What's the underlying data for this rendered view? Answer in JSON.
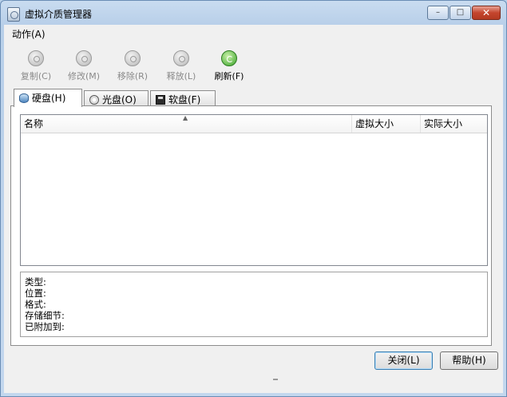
{
  "window": {
    "title": "虚拟介质管理器",
    "minimize_glyph": "–",
    "maximize_glyph": "□",
    "close_glyph": "✕"
  },
  "menubar": {
    "items": [
      {
        "label": "动作(A)"
      }
    ]
  },
  "toolbar": {
    "items": [
      {
        "label": "复制(C)",
        "icon": "copy-disk-icon",
        "enabled": false
      },
      {
        "label": "修改(M)",
        "icon": "modify-disk-icon",
        "enabled": false
      },
      {
        "label": "移除(R)",
        "icon": "remove-disk-icon",
        "enabled": false
      },
      {
        "label": "释放(L)",
        "icon": "release-disk-icon",
        "enabled": false
      },
      {
        "label": "刷新(F)",
        "icon": "refresh-icon",
        "enabled": true
      }
    ]
  },
  "tabs": [
    {
      "label": "硬盘(H)",
      "icon": "hard-disk-icon",
      "active": true
    },
    {
      "label": "光盘(O)",
      "icon": "optical-disc-icon",
      "active": false
    },
    {
      "label": "软盘(F)",
      "icon": "floppy-disk-icon",
      "active": false
    }
  ],
  "list": {
    "columns": [
      {
        "label": "名称"
      },
      {
        "label": "虚拟大小"
      },
      {
        "label": "实际大小"
      }
    ],
    "sort_indicator": "▲",
    "rows": []
  },
  "details": {
    "fields": [
      {
        "label": "类型:"
      },
      {
        "label": "位置:"
      },
      {
        "label": "格式:"
      },
      {
        "label": "存储细节:"
      },
      {
        "label": "已附加到:"
      }
    ]
  },
  "buttons": {
    "close_label": "关闭(L)",
    "help_label": "帮助(H)"
  }
}
